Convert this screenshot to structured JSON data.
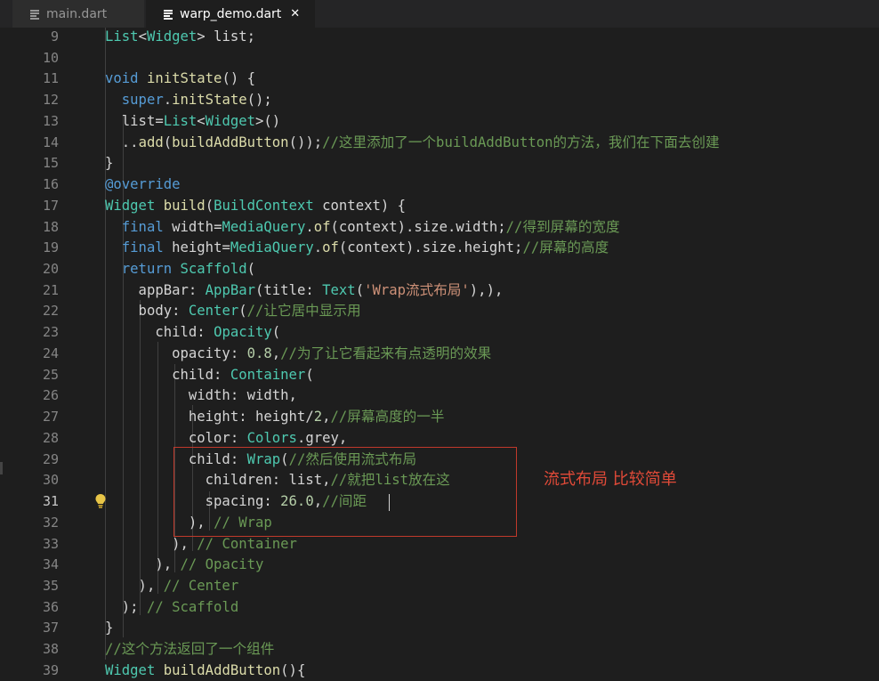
{
  "tabs": [
    {
      "label": "main.dart",
      "icon": "file-lines-icon",
      "active": false
    },
    {
      "label": "warp_demo.dart",
      "icon": "file-lines-icon",
      "active": true,
      "close": "✕"
    }
  ],
  "editor": {
    "active_line": 31,
    "lines": [
      {
        "no": 9,
        "tokens": [
          [
            "t",
            "List"
          ],
          [
            "v",
            "<"
          ],
          [
            "t",
            "Widget"
          ],
          [
            "v",
            "> list;"
          ]
        ]
      },
      {
        "no": 10,
        "tokens": []
      },
      {
        "no": 11,
        "tokens": [
          [
            "k",
            "void"
          ],
          [
            "v",
            " "
          ],
          [
            "f",
            "initState"
          ],
          [
            "v",
            "() {"
          ]
        ]
      },
      {
        "no": 12,
        "tokens": [
          [
            "v",
            "  "
          ],
          [
            "k",
            "super"
          ],
          [
            "v",
            "."
          ],
          [
            "f",
            "initState"
          ],
          [
            "v",
            "();"
          ]
        ]
      },
      {
        "no": 13,
        "tokens": [
          [
            "v",
            "  list="
          ],
          [
            "t",
            "List"
          ],
          [
            "v",
            "<"
          ],
          [
            "t",
            "Widget"
          ],
          [
            "v",
            ">()"
          ]
        ]
      },
      {
        "no": 14,
        "tokens": [
          [
            "v",
            "  .."
          ],
          [
            "f",
            "add"
          ],
          [
            "v",
            "("
          ],
          [
            "f",
            "buildAddButton"
          ],
          [
            "v",
            "());"
          ],
          [
            "c",
            "//这里添加了一个buildAddButton的方法，我们在下面去创建"
          ]
        ]
      },
      {
        "no": 15,
        "tokens": [
          [
            "v",
            "}"
          ]
        ]
      },
      {
        "no": 16,
        "tokens": [
          [
            "k",
            "@override"
          ]
        ]
      },
      {
        "no": 17,
        "tokens": [
          [
            "t",
            "Widget"
          ],
          [
            "v",
            " "
          ],
          [
            "f",
            "build"
          ],
          [
            "v",
            "("
          ],
          [
            "t",
            "BuildContext"
          ],
          [
            "v",
            " context) {"
          ]
        ]
      },
      {
        "no": 18,
        "tokens": [
          [
            "v",
            "  "
          ],
          [
            "k",
            "final"
          ],
          [
            "v",
            " width="
          ],
          [
            "t",
            "MediaQuery"
          ],
          [
            "v",
            "."
          ],
          [
            "f",
            "of"
          ],
          [
            "v",
            "(context).size.width;"
          ],
          [
            "c",
            "//得到屏幕的宽度"
          ]
        ]
      },
      {
        "no": 19,
        "tokens": [
          [
            "v",
            "  "
          ],
          [
            "k",
            "final"
          ],
          [
            "v",
            " height="
          ],
          [
            "t",
            "MediaQuery"
          ],
          [
            "v",
            "."
          ],
          [
            "f",
            "of"
          ],
          [
            "v",
            "(context).size.height;"
          ],
          [
            "c",
            "//屏幕的高度"
          ]
        ]
      },
      {
        "no": 20,
        "tokens": [
          [
            "v",
            "  "
          ],
          [
            "k",
            "return"
          ],
          [
            "v",
            " "
          ],
          [
            "t",
            "Scaffold"
          ],
          [
            "v",
            "("
          ]
        ]
      },
      {
        "no": 21,
        "tokens": [
          [
            "v",
            "    appBar: "
          ],
          [
            "t",
            "AppBar"
          ],
          [
            "v",
            "(title: "
          ],
          [
            "t",
            "Text"
          ],
          [
            "v",
            "("
          ],
          [
            "s",
            "'Wrap流式布局'"
          ],
          [
            "v",
            "),),"
          ]
        ]
      },
      {
        "no": 22,
        "tokens": [
          [
            "v",
            "    body: "
          ],
          [
            "t",
            "Center"
          ],
          [
            "v",
            "("
          ],
          [
            "c",
            "//让它居中显示用"
          ]
        ]
      },
      {
        "no": 23,
        "tokens": [
          [
            "v",
            "      child: "
          ],
          [
            "t",
            "Opacity"
          ],
          [
            "v",
            "("
          ]
        ]
      },
      {
        "no": 24,
        "tokens": [
          [
            "v",
            "        opacity: "
          ],
          [
            "n",
            "0.8"
          ],
          [
            "v",
            ","
          ],
          [
            "c",
            "//为了让它看起来有点透明的效果"
          ]
        ]
      },
      {
        "no": 25,
        "tokens": [
          [
            "v",
            "        child: "
          ],
          [
            "t",
            "Container"
          ],
          [
            "v",
            "("
          ]
        ]
      },
      {
        "no": 26,
        "tokens": [
          [
            "v",
            "          width: width,"
          ]
        ]
      },
      {
        "no": 27,
        "tokens": [
          [
            "v",
            "          height: height/"
          ],
          [
            "n",
            "2"
          ],
          [
            "v",
            ","
          ],
          [
            "c",
            "//屏幕高度的一半"
          ]
        ]
      },
      {
        "no": 28,
        "tokens": [
          [
            "v",
            "          color: "
          ],
          [
            "t",
            "Colors"
          ],
          [
            "v",
            ".grey,"
          ]
        ]
      },
      {
        "no": 29,
        "tokens": [
          [
            "v",
            "          child: "
          ],
          [
            "t",
            "Wrap"
          ],
          [
            "v",
            "("
          ],
          [
            "c",
            "//然后使用流式布局"
          ]
        ]
      },
      {
        "no": 30,
        "tokens": [
          [
            "v",
            "            children: list,"
          ],
          [
            "c",
            "//就把list放在这"
          ]
        ]
      },
      {
        "no": 31,
        "tokens": [
          [
            "v",
            "            spacing: "
          ],
          [
            "n",
            "26.0"
          ],
          [
            "v",
            ","
          ],
          [
            "c",
            "//间距"
          ]
        ]
      },
      {
        "no": 32,
        "tokens": [
          [
            "v",
            "          ), "
          ],
          [
            "c",
            "// Wrap"
          ]
        ]
      },
      {
        "no": 33,
        "tokens": [
          [
            "v",
            "        ), "
          ],
          [
            "c",
            "// Container"
          ]
        ]
      },
      {
        "no": 34,
        "tokens": [
          [
            "v",
            "      ), "
          ],
          [
            "c",
            "// Opacity"
          ]
        ]
      },
      {
        "no": 35,
        "tokens": [
          [
            "v",
            "    ), "
          ],
          [
            "c",
            "// Center"
          ]
        ]
      },
      {
        "no": 36,
        "tokens": [
          [
            "v",
            "  ); "
          ],
          [
            "c",
            "// Scaffold"
          ]
        ]
      },
      {
        "no": 37,
        "tokens": [
          [
            "v",
            "}"
          ]
        ]
      },
      {
        "no": 38,
        "tokens": [
          [
            "c",
            "//这个方法返回了一个组件"
          ]
        ]
      },
      {
        "no": 39,
        "tokens": [
          [
            "t",
            "Widget"
          ],
          [
            "v",
            " "
          ],
          [
            "f",
            "buildAddButton"
          ],
          [
            "v",
            "(){"
          ]
        ]
      }
    ]
  },
  "annotation": {
    "text": "流式布局  比较简单",
    "color": "#e04a38"
  },
  "lightbulb": {
    "icon": "lightbulb-icon",
    "line": 31
  },
  "colors": {
    "background": "#1e1e1e",
    "keyword": "#569cd6",
    "function": "#dcdcaa",
    "type": "#4ec9b0",
    "comment": "#6a9955",
    "string": "#ce9178",
    "number": "#b5cea8",
    "text": "#d4d4d4",
    "highlight_box": "#c0392b"
  }
}
